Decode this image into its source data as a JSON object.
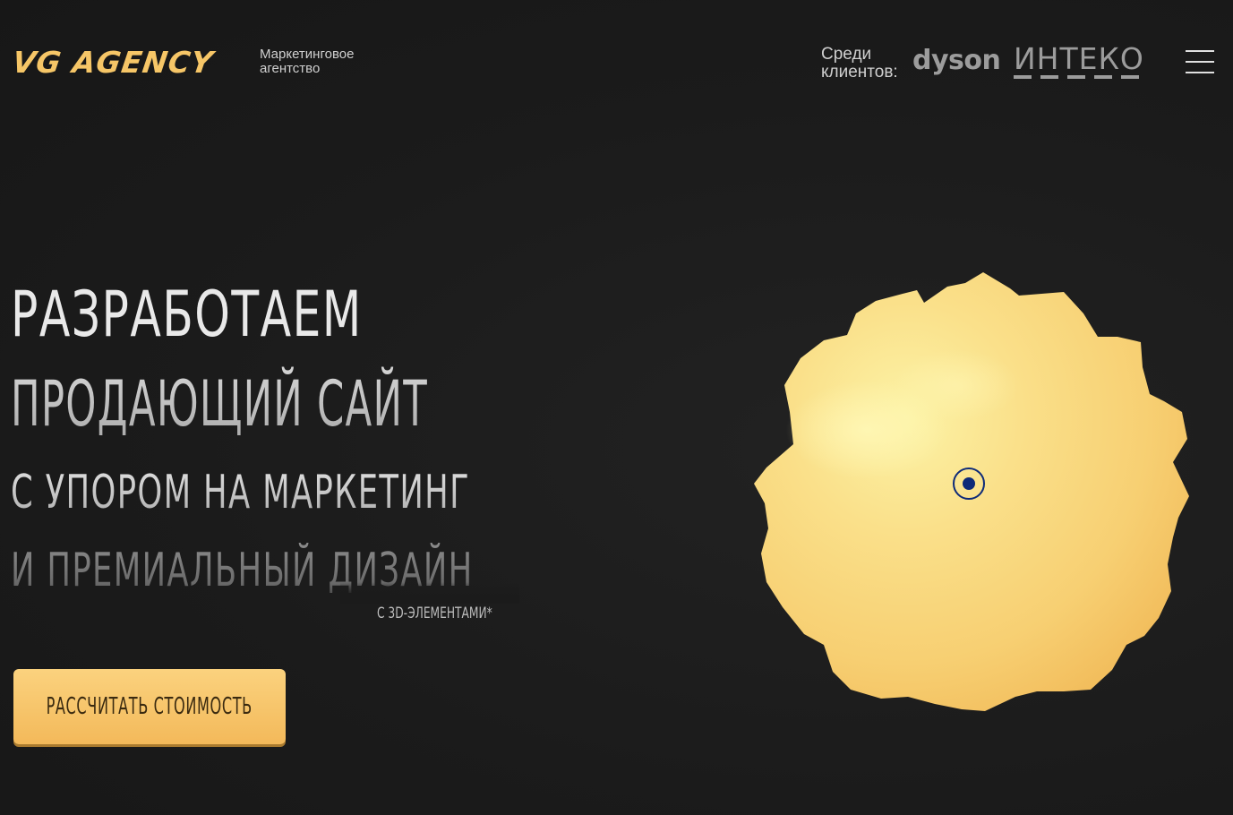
{
  "header": {
    "logo": "VG AGENCY",
    "tagline_line1": "Маркетинговое",
    "tagline_line2": "агентство",
    "clients_line1": "Среди",
    "clients_line2": "клиентов:",
    "client_logos": [
      "dyson",
      "ИНТЕКО"
    ],
    "menu_icon": "hamburger-menu-icon"
  },
  "hero": {
    "line1": "РАЗРАБОТАЕМ",
    "line2": "ПРОДАЮЩИЙ САЙТ",
    "line3": "С УПОРОМ НА МАРКЕТИНГ",
    "line4": "И ПРЕМИАЛЬНЫЙ ДИЗАЙН",
    "note": "С 3D-ЭЛЕМЕНТАМИ*",
    "cta_label": "РАССЧИТАТЬ СТОИМОСТЬ"
  },
  "colors": {
    "background": "#1b1b1b",
    "accent_gold": "#f6c667",
    "blob_light": "#fcf0a0",
    "blob_dark": "#f4c463",
    "cursor": "#0d2a78"
  }
}
